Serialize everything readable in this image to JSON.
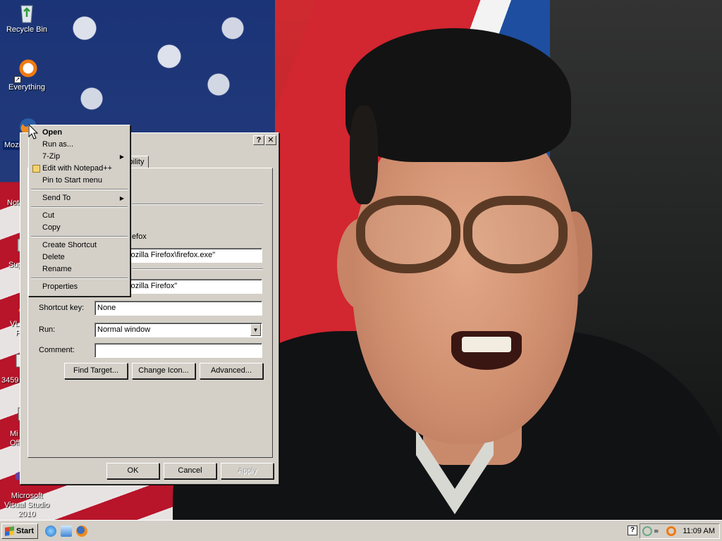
{
  "desktop": {
    "icons": [
      {
        "label": "Recycle Bin",
        "icon": "recycle-bin-icon"
      },
      {
        "label": "Everything",
        "icon": "everything-search-icon"
      },
      {
        "label": "Mozill",
        "icon": "firefox-icon"
      },
      {
        "label": "Note",
        "icon": "notepad-icon"
      },
      {
        "label": "Sup",
        "icon": "app-icon"
      },
      {
        "label": "VL",
        "icon": "vlc-icon"
      },
      {
        "label": "Pl",
        "icon": "app-icon"
      },
      {
        "label": "3459",
        "icon": "file-icon"
      },
      {
        "label": "Mi",
        "icon": "office-icon"
      },
      {
        "label": "Offi",
        "icon": "office-icon"
      },
      {
        "label": "Microsoft Visual Studio 2010",
        "icon": "visual-studio-icon"
      }
    ]
  },
  "context_menu": {
    "items": [
      {
        "label": "Open",
        "bold": true
      },
      {
        "label": "Run as..."
      },
      {
        "label": "7-Zip",
        "submenu": true
      },
      {
        "label": "Edit with Notepad++",
        "icon": "notepad-plus-plus-icon"
      },
      {
        "label": "Pin to Start menu"
      },
      {
        "label": "Send To",
        "submenu": true
      },
      {
        "label": "Cut"
      },
      {
        "label": "Copy"
      },
      {
        "label": "Create Shortcut"
      },
      {
        "label": "Delete"
      },
      {
        "label": "Rename"
      },
      {
        "label": "Properties"
      }
    ]
  },
  "dialog": {
    "help_button": "?",
    "close_button": "✕",
    "tab_partial": "ibility",
    "target_type_partial": "efox",
    "target_value": "m Files\\Mozilla Firefox\\firefox.exe\"",
    "start_in_value": "m Files\\Mozilla Firefox\"",
    "shortcut_key_label": "Shortcut key:",
    "shortcut_key_value": "None",
    "run_label": "Run:",
    "run_value": "Normal window",
    "comment_label": "Comment:",
    "comment_value": "",
    "find_target_button": "Find Target...",
    "change_icon_button": "Change Icon...",
    "advanced_button": "Advanced...",
    "ok_button": "OK",
    "cancel_button": "Cancel",
    "apply_button": "Apply"
  },
  "taskbar": {
    "start_label": "Start",
    "clock": "11:09 AM",
    "quick_launch": [
      "internet-explorer-icon",
      "explorer-icon",
      "firefox-icon"
    ],
    "tray_icons": [
      "help-icon",
      "network-icon",
      "speaker-icon",
      "search-icon"
    ]
  }
}
